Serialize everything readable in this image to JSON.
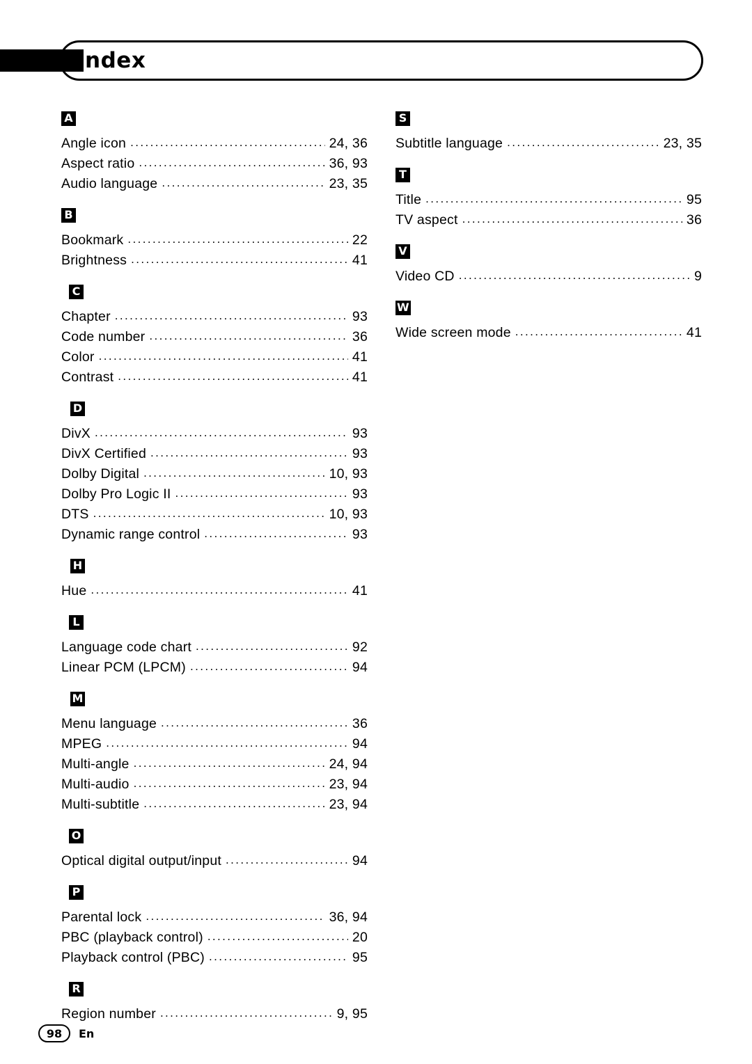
{
  "header": {
    "title": "Index"
  },
  "footer": {
    "page_number": "98",
    "language": "En"
  },
  "columns": [
    {
      "id": "left",
      "groups": [
        {
          "letter": "A",
          "entries": [
            {
              "label": "Angle icon",
              "page": "24, 36"
            },
            {
              "label": "Aspect ratio",
              "page": "36, 93"
            },
            {
              "label": "Audio language",
              "page": "23, 35"
            }
          ]
        },
        {
          "letter": "B",
          "entries": [
            {
              "label": "Bookmark",
              "page": "22"
            },
            {
              "label": "Brightness",
              "page": "41"
            }
          ]
        },
        {
          "letter": "C",
          "entries": [
            {
              "label": "Chapter",
              "page": "93"
            },
            {
              "label": "Code number",
              "page": "36"
            },
            {
              "label": "Color",
              "page": "41"
            },
            {
              "label": "Contrast",
              "page": "41"
            }
          ]
        },
        {
          "letter": "D",
          "entries": [
            {
              "label": "DivX",
              "page": "93"
            },
            {
              "label": "DivX Certified",
              "page": "93"
            },
            {
              "label": "Dolby Digital",
              "page": "10, 93"
            },
            {
              "label": "Dolby Pro Logic II",
              "page": "93"
            },
            {
              "label": "DTS",
              "page": "10, 93"
            },
            {
              "label": "Dynamic range control",
              "page": "93"
            }
          ]
        },
        {
          "letter": "H",
          "entries": [
            {
              "label": "Hue",
              "page": "41"
            }
          ]
        },
        {
          "letter": "L",
          "entries": [
            {
              "label": "Language code chart",
              "page": "92"
            },
            {
              "label": "Linear PCM (LPCM)",
              "page": "94"
            }
          ]
        },
        {
          "letter": "M",
          "entries": [
            {
              "label": "Menu language",
              "page": "36"
            },
            {
              "label": "MPEG",
              "page": "94"
            },
            {
              "label": "Multi-angle",
              "page": "24, 94"
            },
            {
              "label": "Multi-audio",
              "page": "23, 94"
            },
            {
              "label": "Multi-subtitle",
              "page": "23, 94"
            }
          ]
        },
        {
          "letter": "O",
          "entries": [
            {
              "label": "Optical digital output/input",
              "page": "94"
            }
          ]
        },
        {
          "letter": "P",
          "entries": [
            {
              "label": "Parental lock",
              "page": "36, 94"
            },
            {
              "label": "PBC (playback control)",
              "page": "20"
            },
            {
              "label": "Playback control (PBC)",
              "page": "95"
            }
          ]
        },
        {
          "letter": "R",
          "entries": [
            {
              "label": "Region number",
              "page": "9, 95"
            }
          ]
        }
      ]
    },
    {
      "id": "right",
      "groups": [
        {
          "letter": "S",
          "entries": [
            {
              "label": "Subtitle language",
              "page": "23, 35"
            }
          ]
        },
        {
          "letter": "T",
          "entries": [
            {
              "label": "Title",
              "page": "95"
            },
            {
              "label": "TV aspect",
              "page": "36"
            }
          ]
        },
        {
          "letter": "V",
          "entries": [
            {
              "label": "Video CD",
              "page": "9"
            }
          ]
        },
        {
          "letter": "W",
          "entries": [
            {
              "label": "Wide screen mode",
              "page": "41"
            }
          ]
        }
      ]
    }
  ]
}
